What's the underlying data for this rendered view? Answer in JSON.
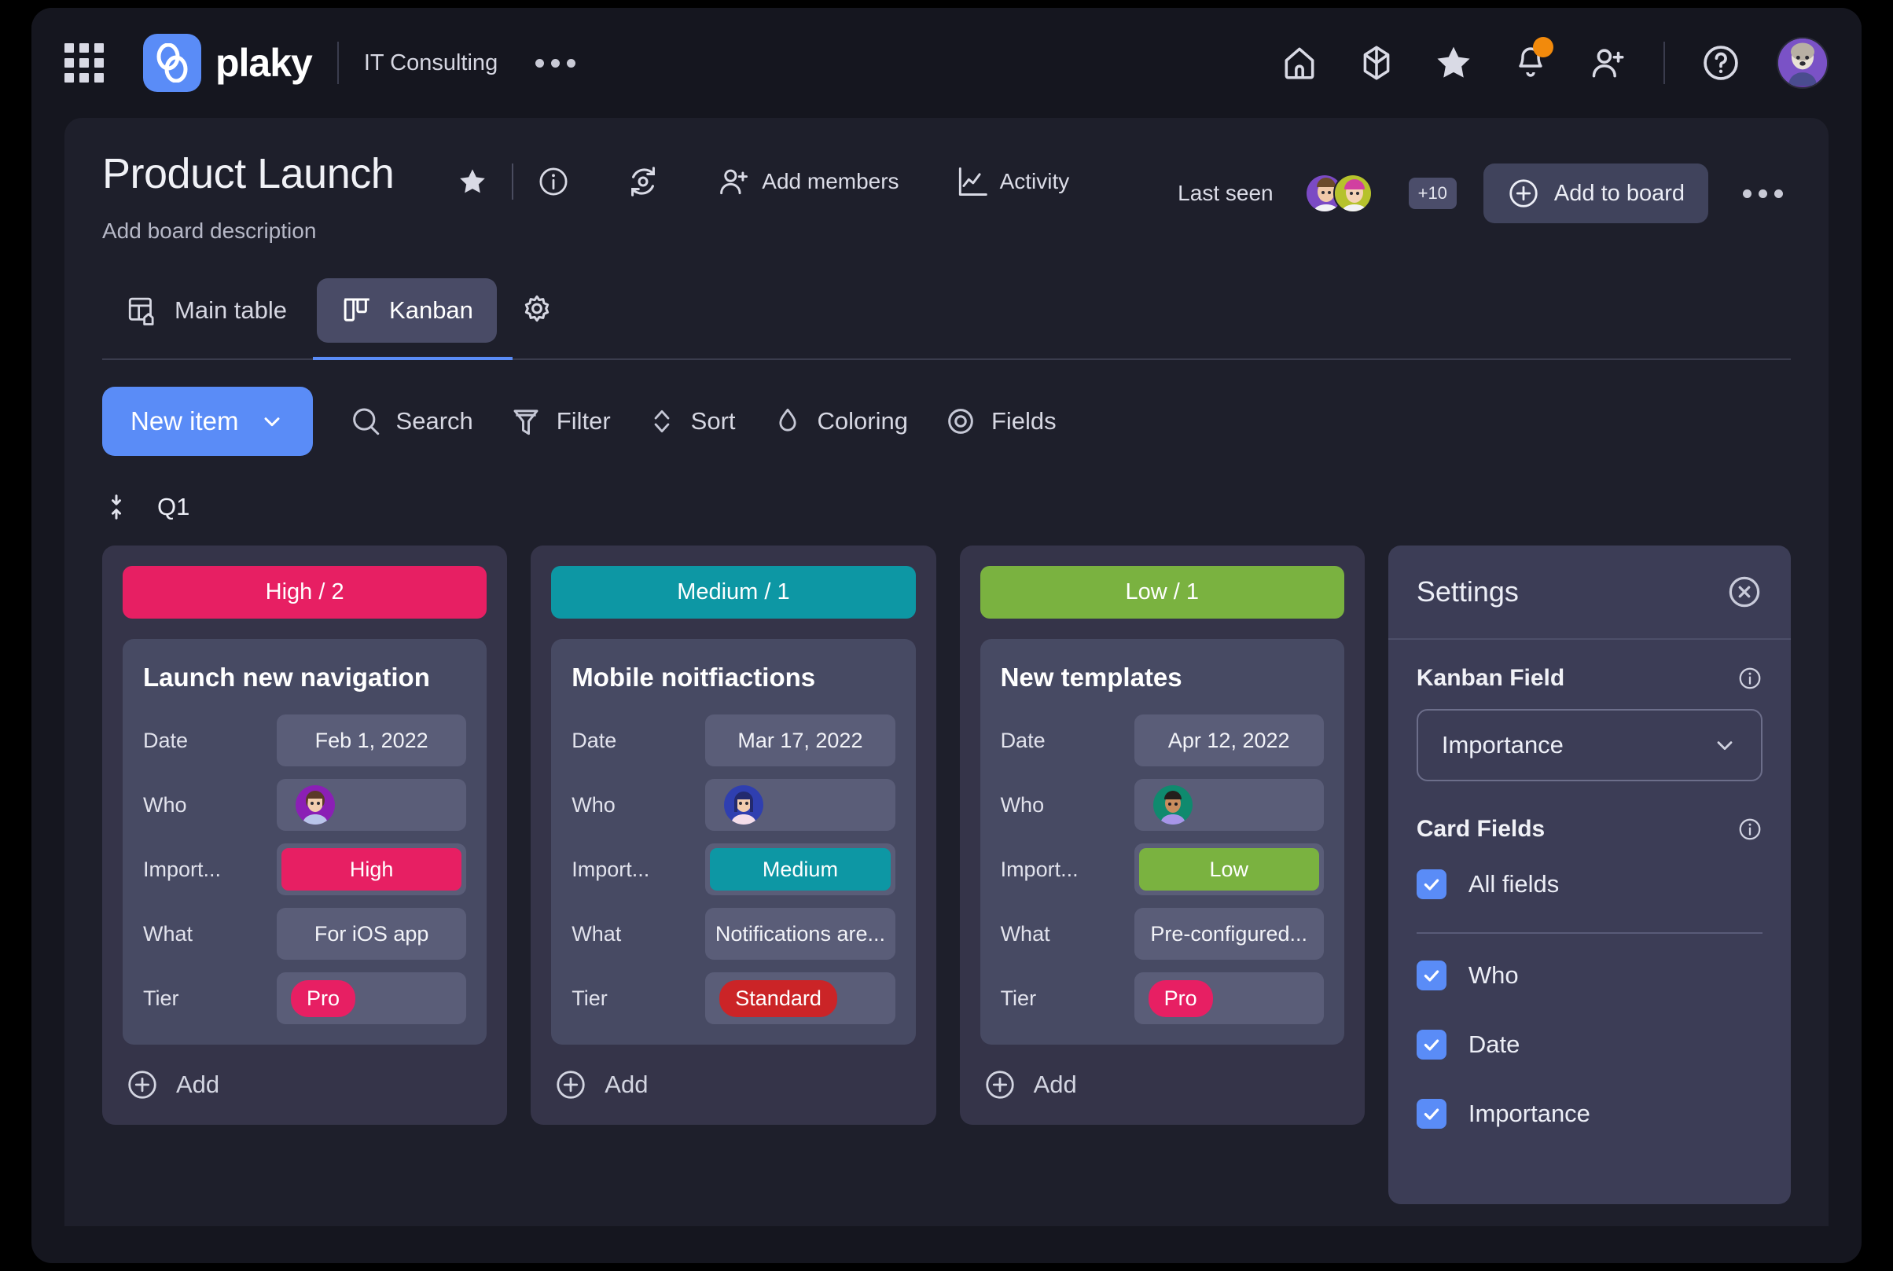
{
  "topbar": {
    "apps_icon": "grid-apps-icon",
    "logo_text": "plaky",
    "workspace": "IT Consulting",
    "overflow_icon": "ellipsis-icon",
    "icons": [
      {
        "name": "home-icon",
        "label": "Home"
      },
      {
        "name": "cube-icon",
        "label": "Boards"
      },
      {
        "name": "star-icon",
        "label": "Favorites"
      },
      {
        "name": "bell-icon",
        "label": "Notifications",
        "badge": true
      },
      {
        "name": "add-person-icon",
        "label": "Invite"
      },
      {
        "name": "help-icon",
        "label": "Help"
      }
    ],
    "avatar": "user-avatar"
  },
  "board": {
    "title": "Product Launch",
    "description": "Add board description",
    "star_icon": "star-icon",
    "info_icon": "info-icon",
    "refresh_icon": "refresh-icon",
    "add_members_label": "Add members",
    "activity_label": "Activity",
    "last_seen_label": "Last seen",
    "avatar_overflow": "+10",
    "add_to_board_label": "Add to board",
    "more_icon": "ellipsis-icon"
  },
  "tabs": [
    {
      "label": "Main table",
      "icon": "table-home-icon",
      "active": false
    },
    {
      "label": "Kanban",
      "icon": "kanban-icon",
      "active": true
    }
  ],
  "tab_settings_icon": "gear-icon",
  "toolbar": {
    "new_item_label": "New item",
    "new_item_chevron": "chevron-down-icon",
    "tools": [
      {
        "label": "Search",
        "icon": "search-icon"
      },
      {
        "label": "Filter",
        "icon": "filter-icon"
      },
      {
        "label": "Sort",
        "icon": "sort-icon"
      },
      {
        "label": "Coloring",
        "icon": "droplet-icon"
      },
      {
        "label": "Fields",
        "icon": "eye-icon"
      }
    ]
  },
  "group": {
    "collapse_icon": "collapse-vertical-icon",
    "name": "Q1"
  },
  "colors": {
    "high": "#e71f63",
    "medium": "#0d97a4",
    "low": "#7ab240",
    "pro": "#e71f63",
    "standard": "#cb2427",
    "accent": "#5a8cf7",
    "badge_orange": "#f28a0c"
  },
  "columns": [
    {
      "header": "High / 2",
      "header_color": "#e71f63",
      "add_label": "Add",
      "card": {
        "title": "Launch new navigation",
        "fields": [
          {
            "key": "Date",
            "value": "Feb 1, 2022",
            "type": "text"
          },
          {
            "key": "Who",
            "value": "",
            "type": "avatar",
            "avatar": "purple-avatar"
          },
          {
            "key": "Import...",
            "value": "High",
            "type": "chip",
            "color": "#e71f63"
          },
          {
            "key": "What",
            "value": "For iOS app",
            "type": "text"
          },
          {
            "key": "Tier",
            "value": "Pro",
            "type": "pill",
            "color": "#e71f63"
          }
        ]
      }
    },
    {
      "header": "Medium / 1",
      "header_color": "#0d97a4",
      "add_label": "Add",
      "card": {
        "title": "Mobile noitfiactions",
        "fields": [
          {
            "key": "Date",
            "value": "Mar 17, 2022",
            "type": "text"
          },
          {
            "key": "Who",
            "value": "",
            "type": "avatar",
            "avatar": "blue-avatar"
          },
          {
            "key": "Import...",
            "value": "Medium",
            "type": "chip",
            "color": "#0d97a4"
          },
          {
            "key": "What",
            "value": "Notifications are...",
            "type": "text"
          },
          {
            "key": "Tier",
            "value": "Standard",
            "type": "pill",
            "color": "#cb2427"
          }
        ]
      }
    },
    {
      "header": "Low / 1",
      "header_color": "#7ab240",
      "add_label": "Add",
      "card": {
        "title": "New templates",
        "fields": [
          {
            "key": "Date",
            "value": "Apr 12, 2022",
            "type": "text"
          },
          {
            "key": "Who",
            "value": "",
            "type": "avatar",
            "avatar": "green-avatar"
          },
          {
            "key": "Import...",
            "value": "Low",
            "type": "chip",
            "color": "#7ab240"
          },
          {
            "key": "What",
            "value": "Pre-configured...",
            "type": "text"
          },
          {
            "key": "Tier",
            "value": "Pro",
            "type": "pill",
            "color": "#e71f63"
          }
        ]
      }
    }
  ],
  "settings": {
    "title": "Settings",
    "close_icon": "close-circle-icon",
    "kanban_field_label": "Kanban Field",
    "kanban_field_info_icon": "info-icon",
    "kanban_field_value": "Importance",
    "kanban_field_chevron": "chevron-down-icon",
    "card_fields_label": "Card Fields",
    "card_fields_info_icon": "info-icon",
    "all_fields_label": "All fields",
    "all_fields_checked": true,
    "fields": [
      {
        "label": "Who",
        "checked": true
      },
      {
        "label": "Date",
        "checked": true
      },
      {
        "label": "Importance",
        "checked": true
      }
    ]
  }
}
